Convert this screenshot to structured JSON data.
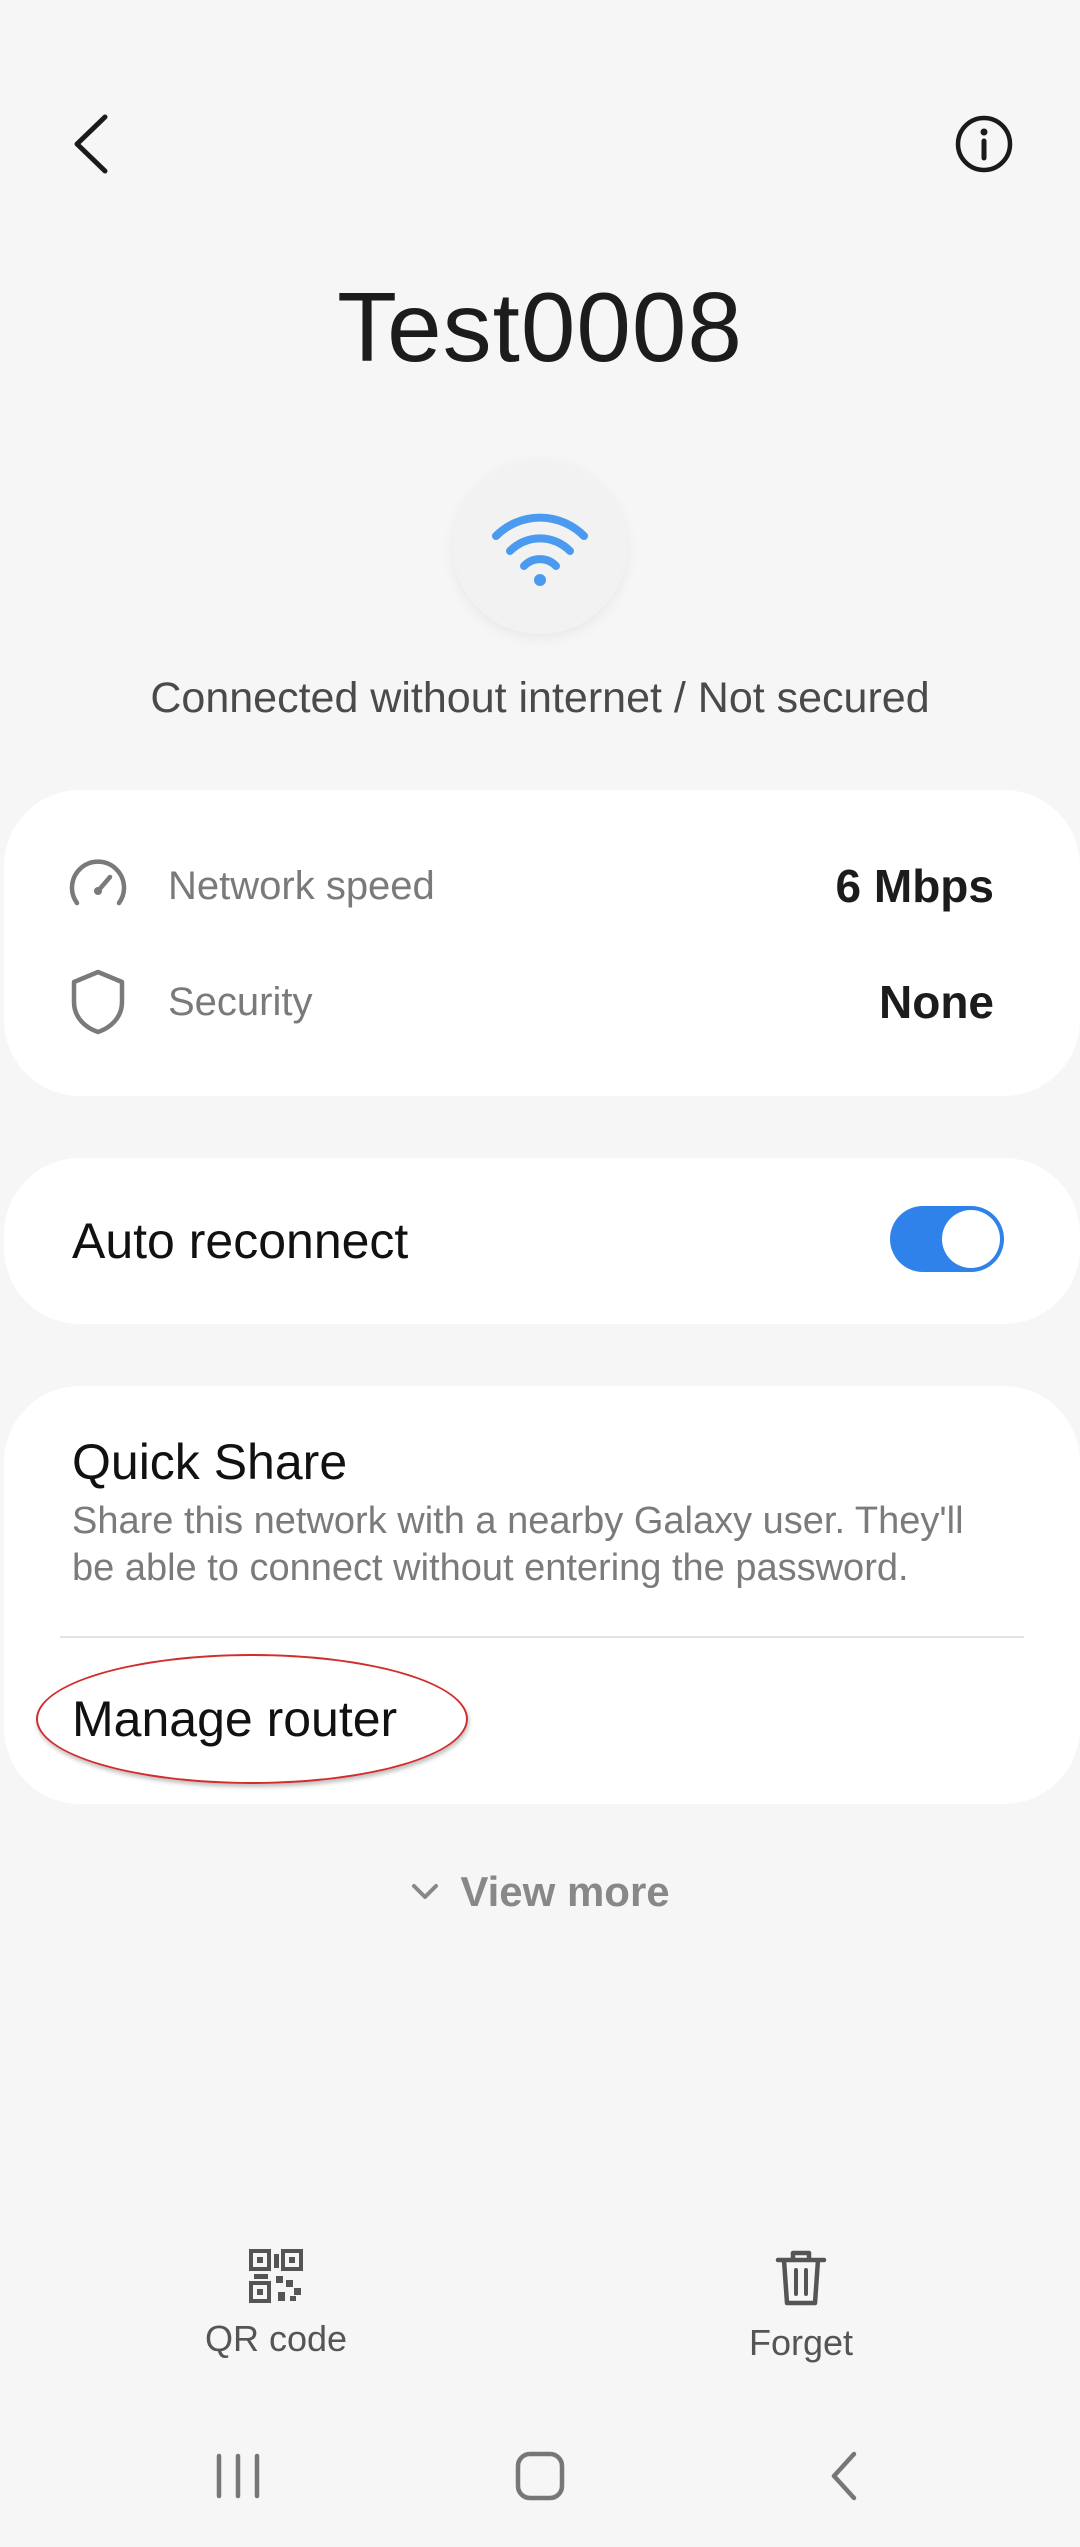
{
  "header": {
    "back_icon": "chevron-left-icon",
    "info_icon": "info-circle-icon"
  },
  "network": {
    "name": "Test0008",
    "wifi_icon": "wifi-icon",
    "status": "Connected without internet / Not secured"
  },
  "details": {
    "speed": {
      "icon": "speedometer-icon",
      "label": "Network speed",
      "value": "6 Mbps"
    },
    "security": {
      "icon": "shield-icon",
      "label": "Security",
      "value": "None"
    }
  },
  "auto_reconnect": {
    "label": "Auto reconnect",
    "enabled": true
  },
  "quick_share": {
    "title": "Quick Share",
    "description": "Share this network with a nearby Galaxy user. They'll be able to connect without entering the password."
  },
  "manage_router": {
    "label": "Manage router"
  },
  "view_more": {
    "label": "View more"
  },
  "actions": {
    "qr": {
      "icon": "qr-code-icon",
      "label": "QR code"
    },
    "forget": {
      "icon": "trash-icon",
      "label": "Forget"
    }
  },
  "navbar": {
    "recent_icon": "recent-apps-icon",
    "home_icon": "home-icon",
    "back_icon": "back-icon"
  },
  "colors": {
    "accent": "#2f82ea",
    "wifi": "#4a9bf0",
    "background": "#f6f6f6",
    "annotation": "#d22c2c"
  }
}
